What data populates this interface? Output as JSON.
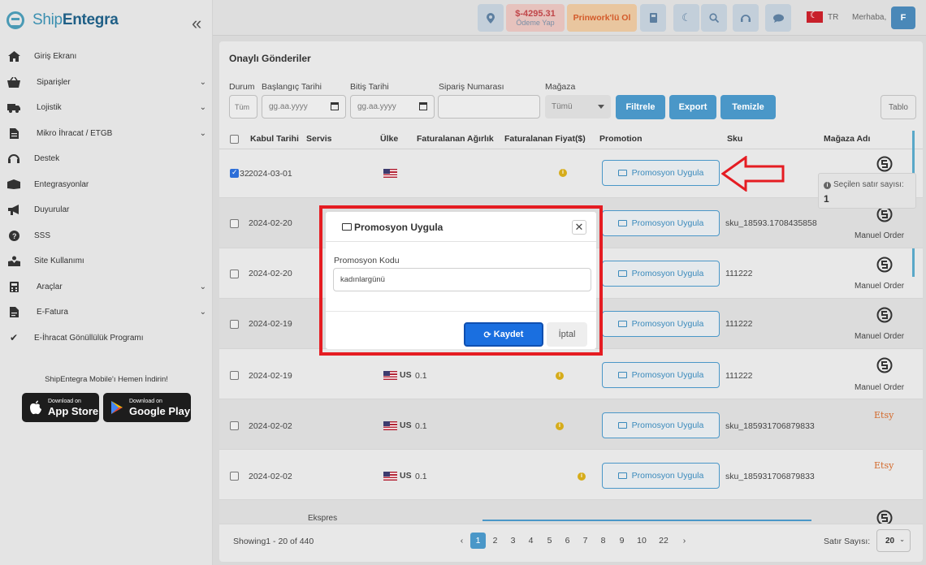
{
  "brand": {
    "name_part1": "Ship",
    "name_part2": "Entegra"
  },
  "sidebar": {
    "items": [
      {
        "label": "Giriş Ekranı",
        "icon": "home-icon",
        "has_children": false
      },
      {
        "label": "Siparişler",
        "icon": "basket-icon",
        "has_children": true
      },
      {
        "label": "Lojistik",
        "icon": "truck-icon",
        "has_children": true
      },
      {
        "label": "Mikro İhracat / ETGB",
        "icon": "document-icon",
        "has_children": true
      },
      {
        "label": "Destek",
        "icon": "headset-icon",
        "has_children": false
      },
      {
        "label": "Entegrasyonlar",
        "icon": "box-icon",
        "has_children": false
      },
      {
        "label": "Duyurular",
        "icon": "megaphone-icon",
        "has_children": false
      },
      {
        "label": "SSS",
        "icon": "question-icon",
        "has_children": false
      },
      {
        "label": "Site Kullanımı",
        "icon": "hand-icon",
        "has_children": false
      },
      {
        "label": "Araçlar",
        "icon": "calculator-icon",
        "has_children": true
      },
      {
        "label": "E-Fatura",
        "icon": "invoice-icon",
        "has_children": true
      },
      {
        "label": "E-İhracat Gönüllülük Programı",
        "icon": "check-icon",
        "has_children": false
      }
    ],
    "mobile_text": "ShipEntegra Mobile'ı Hemen İndirin!",
    "appstore_small": "Download on",
    "appstore_big": "App Store",
    "googleplay_small": "Download on",
    "googleplay_big": "Google Play"
  },
  "topbar": {
    "balance": "$-4295.31",
    "payment": "Ödeme Yap",
    "prinwork": "Prinwork'lü Ol",
    "lang": "TR",
    "greeting": "Merhaba,",
    "avatar": "F"
  },
  "page": {
    "title": "Onaylı Gönderiler",
    "filters": {
      "durum_label": "Durum",
      "durum_value": "Tüm",
      "start_label": "Başlangıç Tarihi",
      "start_value": "gg.aa.yyyy",
      "end_label": "Bitiş Tarihi",
      "end_value": "gg.aa.yyyy",
      "order_label": "Sipariş Numarası",
      "store_label": "Mağaza",
      "store_value": "Tümü",
      "filter_btn": "Filtrele",
      "export_btn": "Export",
      "clear_btn": "Temizle",
      "table_btn": "Tablo"
    },
    "columns": [
      "Kabul Tarihi",
      "Servis",
      "Ülke",
      "Faturalanan Ağırlık",
      "Faturalanan Fiyat($)",
      "Promotion",
      "Sku",
      "Mağaza Adı"
    ],
    "promo_label": "Promosyon Uygula",
    "rows": [
      {
        "id": "32",
        "date": "2024-03-01",
        "country": "",
        "weight": "",
        "sku": "",
        "store": "",
        "checked": true
      },
      {
        "id": "",
        "date": "2024-02-20",
        "country": "",
        "weight": "",
        "sku": "sku_18593.1708435858",
        "store": "Manuel Order",
        "checked": false
      },
      {
        "id": "",
        "date": "2024-02-20",
        "country": "",
        "weight": "",
        "sku": "111222",
        "store": "Manuel Order",
        "checked": false
      },
      {
        "id": "",
        "date": "2024-02-19",
        "country": "",
        "weight": "",
        "sku": "111222",
        "store": "Manuel Order",
        "checked": false
      },
      {
        "id": "",
        "date": "2024-02-19",
        "country": "US",
        "weight": "0.1",
        "sku": "111222",
        "store": "Manuel Order",
        "checked": false
      },
      {
        "id": "",
        "date": "2024-02-02",
        "country": "US",
        "weight": "0.1",
        "sku": "sku_185931706879833",
        "store": "Etsy",
        "checked": false
      },
      {
        "id": "",
        "date": "2024-02-02",
        "country": "US",
        "weight": "0.1",
        "sku": "sku_185931706879833",
        "store": "Etsy",
        "checked": false
      }
    ],
    "partial_row_service": "Ekspres",
    "pagination": {
      "showing": "Showing1 - 20 of 440",
      "pages": [
        "1",
        "2",
        "3",
        "4",
        "5",
        "6",
        "7",
        "8",
        "9",
        "10",
        "22"
      ],
      "active": "1",
      "rows_label": "Satır Sayısı:",
      "rows_value": "20"
    }
  },
  "tooltip": {
    "label": "Seçilen satır sayısı:",
    "value": "1"
  },
  "modal": {
    "title": "Promosyon Uygula",
    "field_label": "Promosyon Kodu",
    "field_value": "kadınlargünü",
    "save_btn": "Kaydet",
    "cancel_btn": "İptal"
  },
  "colors": {
    "accent": "#4a97c8",
    "highlight": "#e51c22",
    "save": "#1a6fe0"
  }
}
